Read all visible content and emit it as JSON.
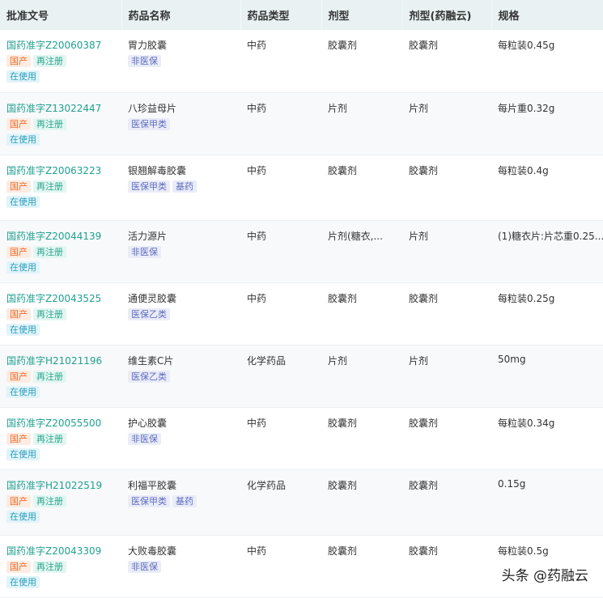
{
  "headers": [
    "批准文号",
    "药品名称",
    "药品类型",
    "剂型",
    "剂型(药融云)",
    "规格"
  ],
  "rows": [
    {
      "approval": "国药准字Z20060387",
      "tags": [
        "国产",
        "再注册"
      ],
      "status": "在使用",
      "name": "胃力胶囊",
      "insurance": [
        "非医保"
      ],
      "type": "中药",
      "form": "胶囊剂",
      "form2": "胶囊剂",
      "spec": "每粒装0.45g"
    },
    {
      "approval": "国药准字Z13022447",
      "tags": [
        "国产",
        "再注册"
      ],
      "status": "在使用",
      "name": "八珍益母片",
      "insurance": [
        "医保甲类"
      ],
      "type": "中药",
      "form": "片剂",
      "form2": "片剂",
      "spec": "每片重0.32g"
    },
    {
      "approval": "国药准字Z20063223",
      "tags": [
        "国产",
        "再注册"
      ],
      "status": "在使用",
      "name": "银翘解毒胶囊",
      "insurance": [
        "医保甲类",
        "基药"
      ],
      "type": "中药",
      "form": "胶囊剂",
      "form2": "胶囊剂",
      "spec": "每粒装0.4g"
    },
    {
      "approval": "国药准字Z20044139",
      "tags": [
        "国产",
        "再注册"
      ],
      "status": "在使用",
      "name": "活力源片",
      "insurance": [
        "非医保"
      ],
      "type": "中药",
      "form": "片剂(糖衣,...",
      "form2": "片剂",
      "spec": "(1)糖衣片:片芯重0.25..."
    },
    {
      "approval": "国药准字Z20043525",
      "tags": [
        "国产",
        "再注册"
      ],
      "status": "在使用",
      "name": "通便灵胶囊",
      "insurance": [
        "医保乙类"
      ],
      "type": "中药",
      "form": "胶囊剂",
      "form2": "胶囊剂",
      "spec": "每粒装0.25g"
    },
    {
      "approval": "国药准字H21021196",
      "tags": [
        "国产",
        "再注册"
      ],
      "status": "在使用",
      "name": "维生素C片",
      "insurance": [
        "医保乙类"
      ],
      "type": "化学药品",
      "form": "片剂",
      "form2": "片剂",
      "spec": "50mg"
    },
    {
      "approval": "国药准字Z20055500",
      "tags": [
        "国产",
        "再注册"
      ],
      "status": "在使用",
      "name": "护心胶囊",
      "insurance": [
        "非医保"
      ],
      "type": "中药",
      "form": "胶囊剂",
      "form2": "胶囊剂",
      "spec": "每粒装0.34g"
    },
    {
      "approval": "国药准字H21022519",
      "tags": [
        "国产",
        "再注册"
      ],
      "status": "在使用",
      "name": "利福平胶囊",
      "insurance": [
        "医保甲类",
        "基药"
      ],
      "type": "化学药品",
      "form": "胶囊剂",
      "form2": "胶囊剂",
      "spec": "0.15g"
    },
    {
      "approval": "国药准字Z20043309",
      "tags": [
        "国产",
        "再注册"
      ],
      "status": "在使用",
      "name": "大败毒胶囊",
      "insurance": [
        "非医保"
      ],
      "type": "中药",
      "form": "胶囊剂",
      "form2": "胶囊剂",
      "spec": "每粒装0.5g"
    }
  ],
  "watermark": "头条 @药融云"
}
